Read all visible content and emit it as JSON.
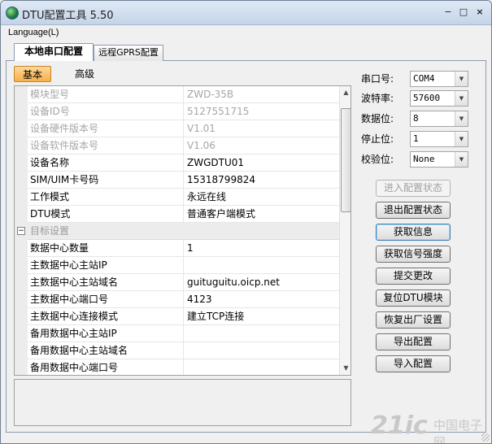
{
  "window": {
    "title": "DTU配置工具 5.50",
    "minimize_glyph": "−",
    "maximize_glyph": "□",
    "close_glyph": "×"
  },
  "menu": {
    "language": "Language(L)"
  },
  "tabs": [
    {
      "label": "本地串口配置",
      "active": true
    },
    {
      "label": "远程GPRS配置",
      "active": false
    }
  ],
  "subtabs": [
    {
      "label": "基本",
      "active": true
    },
    {
      "label": "高级",
      "active": false
    }
  ],
  "properties": [
    {
      "key": "模块型号",
      "value": "ZWD-35B",
      "disabled": true
    },
    {
      "key": "设备ID号",
      "value": "5127551715",
      "disabled": true
    },
    {
      "key": "设备硬件版本号",
      "value": "V1.01",
      "disabled": true
    },
    {
      "key": "设备软件版本号",
      "value": "V1.06",
      "disabled": true
    },
    {
      "key": "设备名称",
      "value": "ZWGDTU01"
    },
    {
      "key": "SIM/UIM卡号码",
      "value": "15318799824"
    },
    {
      "key": "工作模式",
      "value": "永远在线"
    },
    {
      "key": "DTU模式",
      "value": "普通客户端模式"
    },
    {
      "key": "目标设置",
      "value": "",
      "category": true,
      "expander": "−"
    },
    {
      "key": "数据中心数量",
      "value": "1"
    },
    {
      "key": "主数据中心主站IP",
      "value": ""
    },
    {
      "key": "主数据中心主站域名",
      "value": "guituguitu.oicp.net"
    },
    {
      "key": "主数据中心端口号",
      "value": "4123"
    },
    {
      "key": "主数据中心连接模式",
      "value": "建立TCP连接"
    },
    {
      "key": "备用数据中心主站IP",
      "value": ""
    },
    {
      "key": "备用数据中心主站域名",
      "value": ""
    },
    {
      "key": "备用数据中心端口号",
      "value": ""
    }
  ],
  "serial": {
    "port_label": "串口号:",
    "port_value": "COM4",
    "baud_label": "波特率:",
    "baud_value": "57600",
    "databits_label": "数据位:",
    "databits_value": "8",
    "stopbits_label": "停止位:",
    "stopbits_value": "1",
    "parity_label": "校验位:",
    "parity_value": "None"
  },
  "buttons": {
    "enter_config": "进入配置状态",
    "exit_config": "退出配置状态",
    "get_info": "获取信息",
    "get_signal": "获取信号强度",
    "submit": "提交更改",
    "reset": "复位DTU模块",
    "factory": "恢复出厂设置",
    "export": "导出配置",
    "import": "导入配置"
  },
  "watermark": {
    "logo": "21ic",
    "site": "中国电子网"
  },
  "icons": {
    "app": "globe-icon",
    "dropdown": "chevron-down-icon"
  }
}
